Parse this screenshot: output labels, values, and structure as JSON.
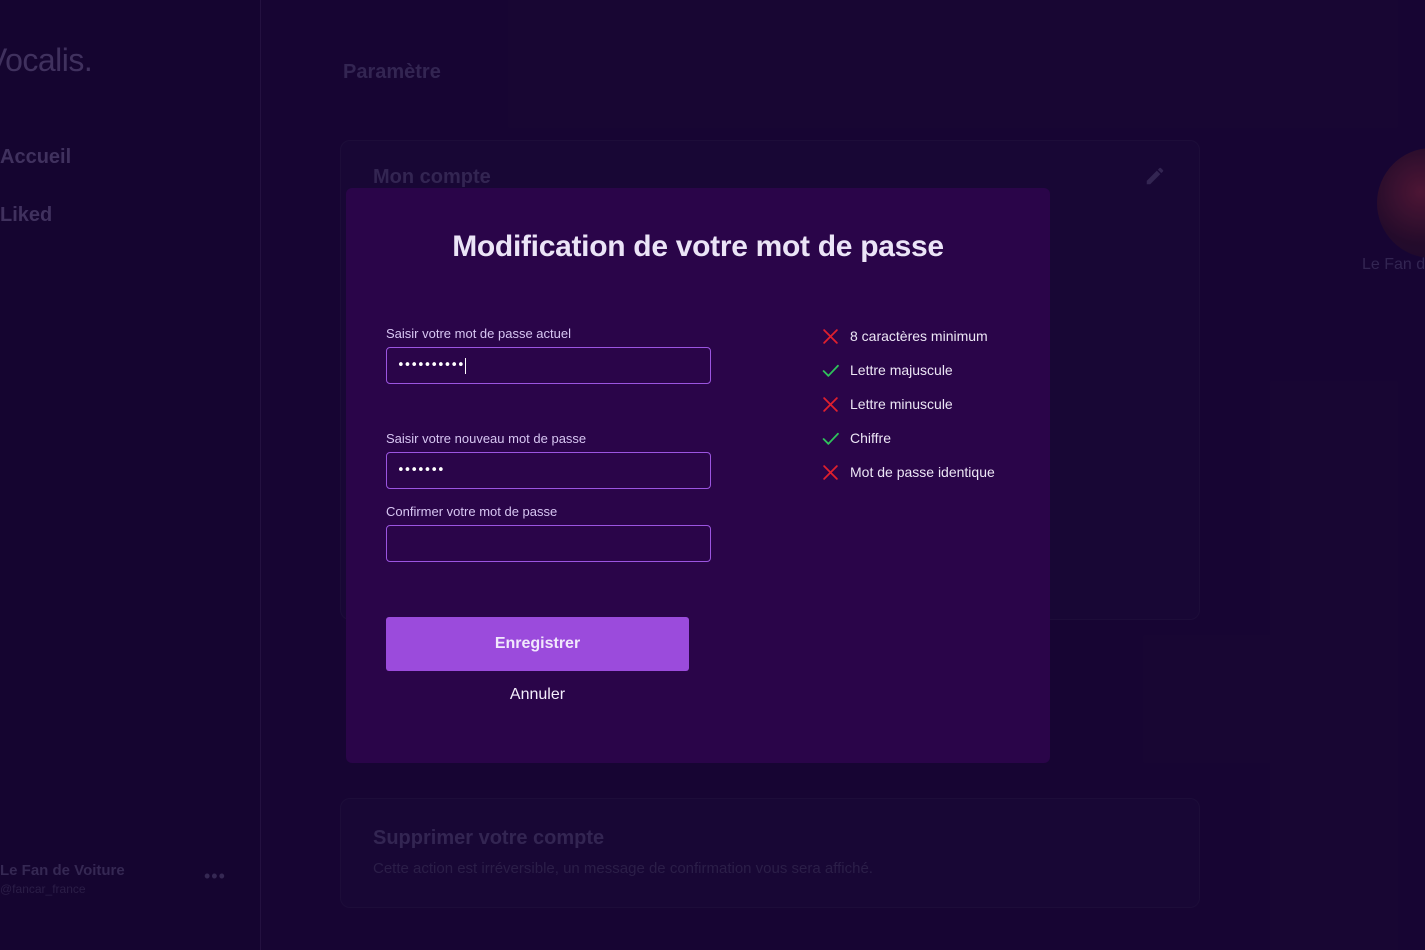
{
  "sidebar": {
    "logo": "Vocalis.",
    "items": [
      {
        "label": "Accueil"
      },
      {
        "label": "Liked"
      }
    ],
    "user": {
      "name": "Le Fan de Voiture",
      "handle": "@fancar_france"
    },
    "more_label": "•••"
  },
  "main": {
    "title": "Paramètre",
    "account_card": {
      "title": "Mon compte"
    },
    "delete_card": {
      "title": "Supprimer votre compte",
      "description": "Cette action est irréversible, un message de confirmation vous sera affiché."
    },
    "profile": {
      "name": "Le Fan de Voiture"
    }
  },
  "modal": {
    "title": "Modification de votre mot de passe",
    "fields": {
      "current": {
        "label": "Saisir votre mot de passe actuel",
        "value": "••••••••••"
      },
      "new": {
        "label": "Saisir votre nouveau mot de passe",
        "value": "•••••••"
      },
      "confirm": {
        "label": "Confirmer votre mot de passe",
        "value": ""
      }
    },
    "rules": [
      {
        "label": "8 caractères minimum",
        "status": "fail",
        "icon": "cross-icon"
      },
      {
        "label": "Lettre majuscule",
        "status": "pass",
        "icon": "check-icon"
      },
      {
        "label": "Lettre minuscule",
        "status": "fail",
        "icon": "cross-icon"
      },
      {
        "label": "Chiffre",
        "status": "pass",
        "icon": "check-icon"
      },
      {
        "label": "Mot de passe identique",
        "status": "fail",
        "icon": "cross-icon"
      }
    ],
    "save_label": "Enregistrer",
    "cancel_label": "Annuler"
  },
  "colors": {
    "background": "#1a0738",
    "modal_bg": "#2a0549",
    "accent": "#9b4bdc",
    "field_border": "#9b55e0",
    "pass": "#2fc35b",
    "fail": "#e0202e"
  }
}
